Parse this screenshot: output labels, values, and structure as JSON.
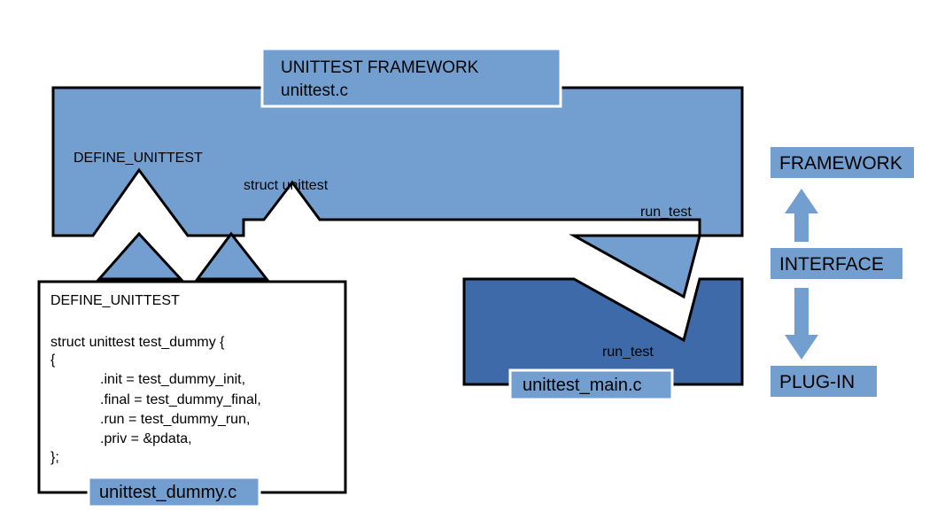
{
  "top_box": {
    "title_line1": "UNITTEST FRAMEWORK",
    "title_line2": "unittest.c",
    "define_label": "DEFINE_UNITTEST",
    "struct_label": "struct unittest",
    "run_label": "run_test"
  },
  "bottom_right": {
    "run_label": "run_test",
    "file_label": "unittest_main.c"
  },
  "code_box": {
    "line1": "DEFINE_UNITTEST",
    "line2": "struct unittest test_dummy {",
    "line3": "{",
    "line4": ".init = test_dummy_init,",
    "line5": ".final = test_dummy_final,",
    "line6": ".run = test_dummy_run,",
    "line7": ".priv = &pdata,",
    "line8": "};",
    "file_label": "unittest_dummy.c"
  },
  "right_labels": {
    "framework": "FRAMEWORK",
    "interface": "INTERFACE",
    "plugin": "PLUG-IN"
  },
  "colors": {
    "light_blue": "#729fcf",
    "dark_blue": "#3e6aa9",
    "black": "#000000",
    "white": "#ffffff"
  }
}
